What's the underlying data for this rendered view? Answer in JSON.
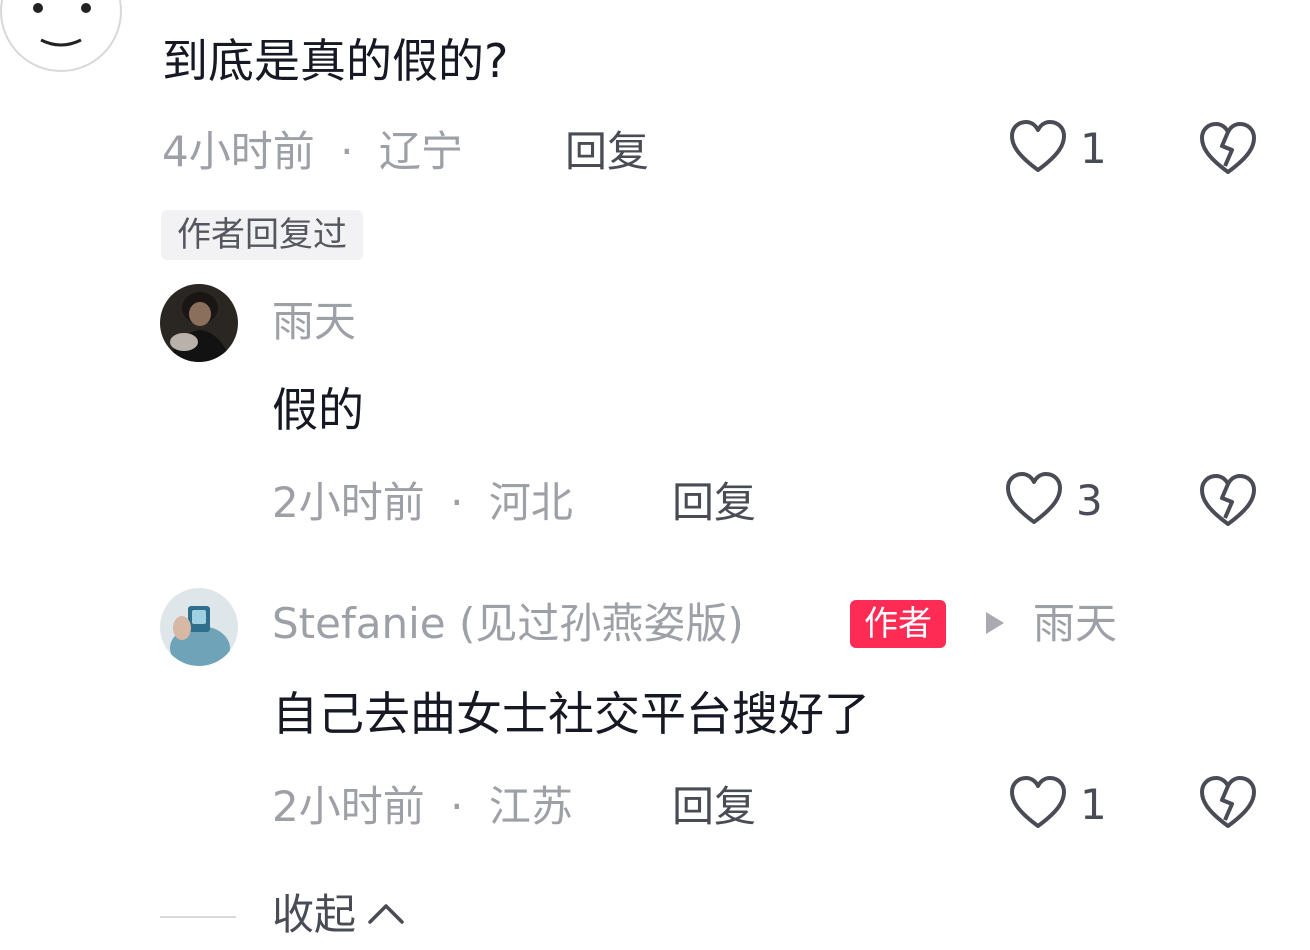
{
  "top_comment": {
    "text": "到底是真的假的?",
    "time": "4小时前",
    "location": "辽宁",
    "dot": "·",
    "reply_label": "回复",
    "likes": "1",
    "author_replied_label": "作者回复过"
  },
  "replies": [
    {
      "username": "雨天",
      "text": "假的",
      "time": "2小时前",
      "location": "河北",
      "dot": "·",
      "reply_label": "回复",
      "likes": "3"
    },
    {
      "username": "Stefanie (见过孙燕姿版)",
      "author_badge": "作者",
      "reply_to": "雨天",
      "text": "自己去曲女士社交平台搜好了",
      "time": "2小时前",
      "location": "江苏",
      "dot": "·",
      "reply_label": "回复",
      "likes": "1"
    }
  ],
  "collapse": {
    "label": "收起"
  },
  "icons": {
    "like": "heart-outline-icon",
    "dislike": "broken-heart-icon",
    "reply_arrow": "play-triangle-icon",
    "collapse": "chevron-up-icon"
  },
  "colors": {
    "text": "#161823",
    "meta": "#9ea0a7",
    "reply": "#4a4c55",
    "author_badge": "#fe2c55"
  }
}
